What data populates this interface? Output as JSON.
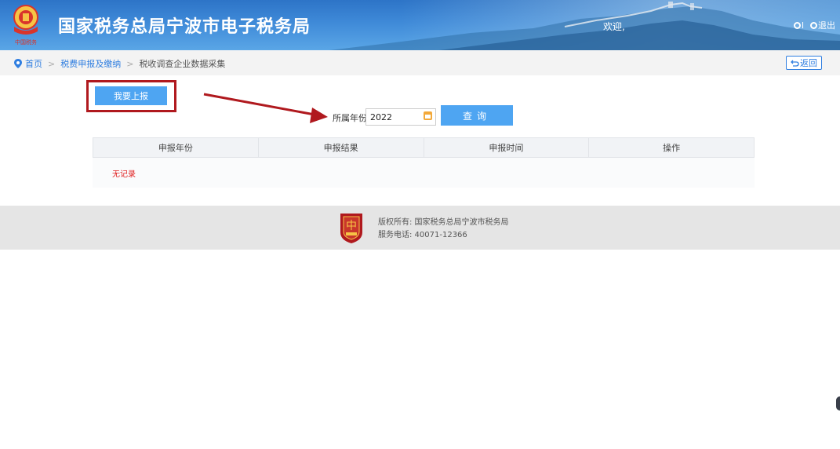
{
  "header": {
    "title": "国家税务总局宁波市电子税务局",
    "welcome": "欢迎,",
    "icons": [
      {
        "name": "search-icon",
        "label": ""
      },
      {
        "name": "logout-icon",
        "label": "退出"
      }
    ]
  },
  "breadcrumb": {
    "home": "首页",
    "level1": "税费申报及缴纳",
    "current": "税收调查企业数据采集"
  },
  "back_button": "返回",
  "actions": {
    "report_button": "我要上报",
    "year_label": "所属年份:",
    "year_value": "2022",
    "query_button": "查询"
  },
  "table": {
    "columns": [
      "申报年份",
      "申报结果",
      "申报时间",
      "操作"
    ],
    "empty_text": "无记录"
  },
  "footer": {
    "copyright": "版权所有: 国家税务总局宁波市税务局",
    "phone": "服务电话: 40071-12366"
  },
  "colors": {
    "primary": "#4ea5f2",
    "header": "#2d74c7",
    "annotation": "#b0191e",
    "empty_text": "#e02020"
  }
}
